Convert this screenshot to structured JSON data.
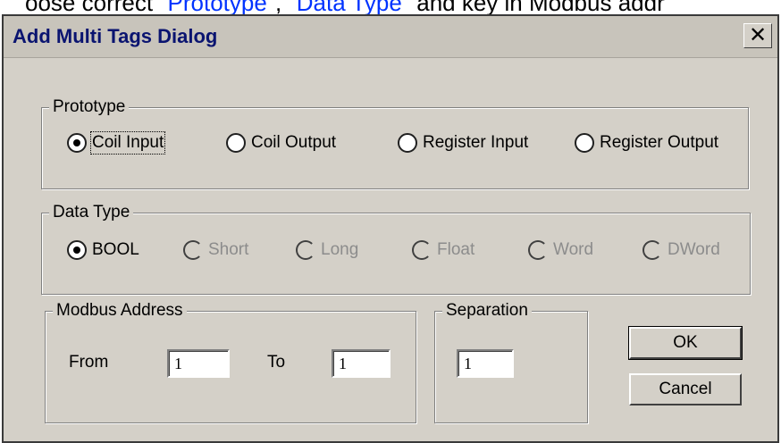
{
  "doc_text": {
    "prefix": "oose correct \"",
    "link1": "Prototype",
    "middle": "\", \"",
    "link2": "Data Type",
    "suffix": "\" and key in Modbus addr"
  },
  "dialog": {
    "title": "Add Multi Tags Dialog",
    "close_glyph": "✕"
  },
  "prototype": {
    "label": "Prototype",
    "options": [
      "Coil Input",
      "Coil Output",
      "Register Input",
      "Register Output"
    ],
    "selected": "Coil Input"
  },
  "data_type": {
    "label": "Data Type",
    "options": [
      "BOOL",
      "Short",
      "Long",
      "Float",
      "Word",
      "DWord"
    ],
    "selected": "BOOL"
  },
  "modbus_address": {
    "label": "Modbus Address",
    "from_label": "From",
    "from_value": "1",
    "to_label": "To",
    "to_value": "1"
  },
  "separation": {
    "label": "Separation",
    "value": "1"
  },
  "buttons": {
    "ok": "OK",
    "cancel": "Cancel"
  }
}
